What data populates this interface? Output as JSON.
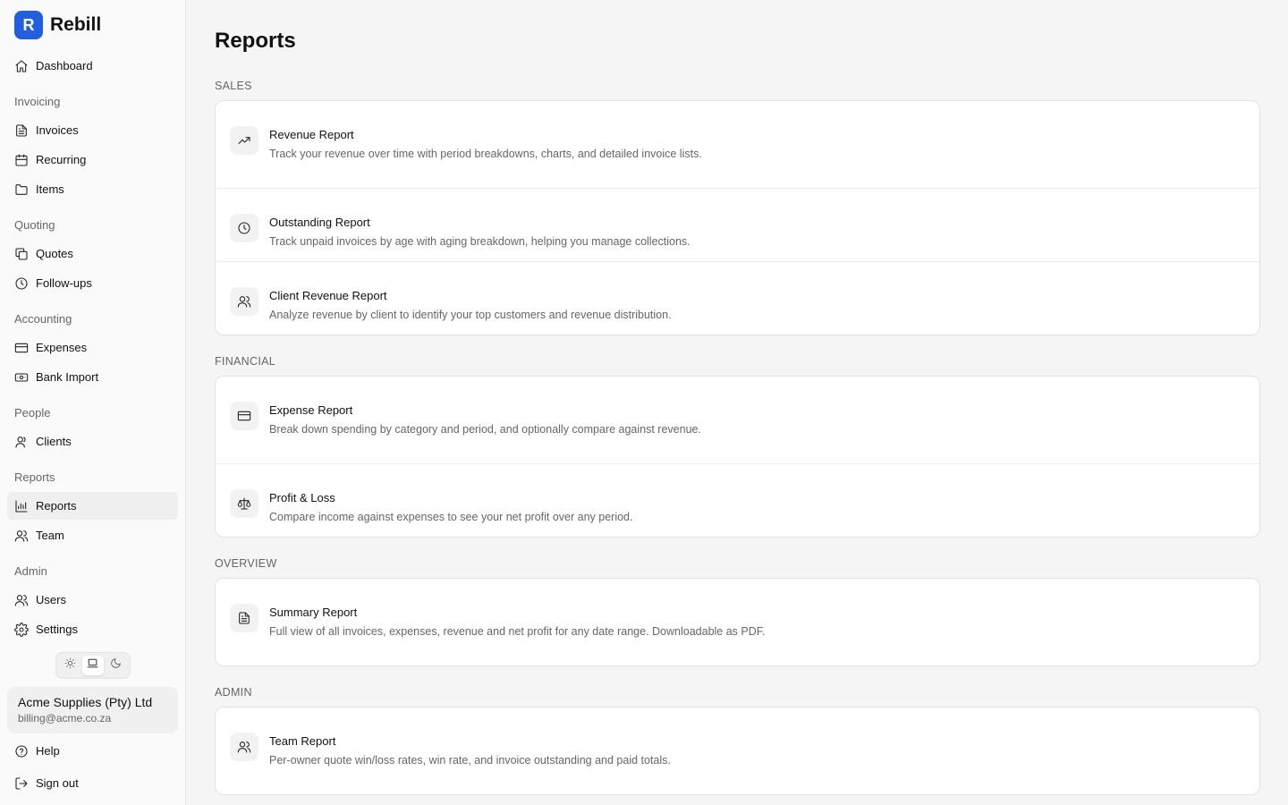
{
  "brand": {
    "logo_letter": "R",
    "name": "Rebill",
    "color": "#1f5fe0"
  },
  "sidebar": {
    "dashboard": {
      "label": "Dashboard",
      "icon": "home-icon"
    },
    "groups": [
      {
        "label": "Invoicing",
        "items": [
          {
            "label": "Invoices",
            "icon": "file-text-icon"
          },
          {
            "label": "Recurring",
            "icon": "calendar-icon"
          },
          {
            "label": "Items",
            "icon": "folder-icon"
          }
        ]
      },
      {
        "label": "Quoting",
        "items": [
          {
            "label": "Quotes",
            "icon": "copy-icon"
          },
          {
            "label": "Follow-ups",
            "icon": "clock-icon"
          }
        ]
      },
      {
        "label": "Accounting",
        "items": [
          {
            "label": "Expenses",
            "icon": "credit-card-icon"
          },
          {
            "label": "Bank Import",
            "icon": "banknote-icon"
          }
        ]
      },
      {
        "label": "People",
        "items": [
          {
            "label": "Clients",
            "icon": "user-icon"
          }
        ]
      },
      {
        "label": "Reports",
        "items": [
          {
            "label": "Reports",
            "icon": "bar-chart-icon",
            "active": true
          },
          {
            "label": "Team",
            "icon": "users-icon"
          }
        ]
      },
      {
        "label": "Admin",
        "items": [
          {
            "label": "Users",
            "icon": "users-icon"
          },
          {
            "label": "Settings",
            "icon": "gear-icon"
          }
        ]
      }
    ],
    "theme": {
      "options": [
        "light",
        "system",
        "dark"
      ],
      "selected": "system"
    },
    "account": {
      "name": "Acme Supplies (Pty) Ltd",
      "email": "billing@acme.co.za"
    },
    "help_label": "Help",
    "signout_label": "Sign out"
  },
  "main": {
    "title": "Reports",
    "sections": [
      {
        "label": "SALES",
        "reports": [
          {
            "title": "Revenue Report",
            "description": "Track your revenue over time with period breakdowns, charts, and detailed invoice lists.",
            "icon": "trending-up-icon"
          },
          {
            "title": "Outstanding Report",
            "description": "Track unpaid invoices by age with aging breakdown, helping you manage collections.",
            "icon": "clock-icon"
          },
          {
            "title": "Client Revenue Report",
            "description": "Analyze revenue by client to identify your top customers and revenue distribution.",
            "icon": "users-icon"
          }
        ]
      },
      {
        "label": "FINANCIAL",
        "reports": [
          {
            "title": "Expense Report",
            "description": "Break down spending by category and period, and optionally compare against revenue.",
            "icon": "credit-card-icon"
          },
          {
            "title": "Profit & Loss",
            "description": "Compare income against expenses to see your net profit over any period.",
            "icon": "scale-icon"
          }
        ]
      },
      {
        "label": "OVERVIEW",
        "reports": [
          {
            "title": "Summary Report",
            "description": "Full view of all invoices, expenses, revenue and net profit for any date range. Downloadable as PDF.",
            "icon": "file-text-icon"
          }
        ]
      },
      {
        "label": "ADMIN",
        "reports": [
          {
            "title": "Team Report",
            "description": "Per-owner quote win/loss rates, win rate, and invoice outstanding and paid totals.",
            "icon": "users-icon"
          }
        ]
      }
    ]
  }
}
